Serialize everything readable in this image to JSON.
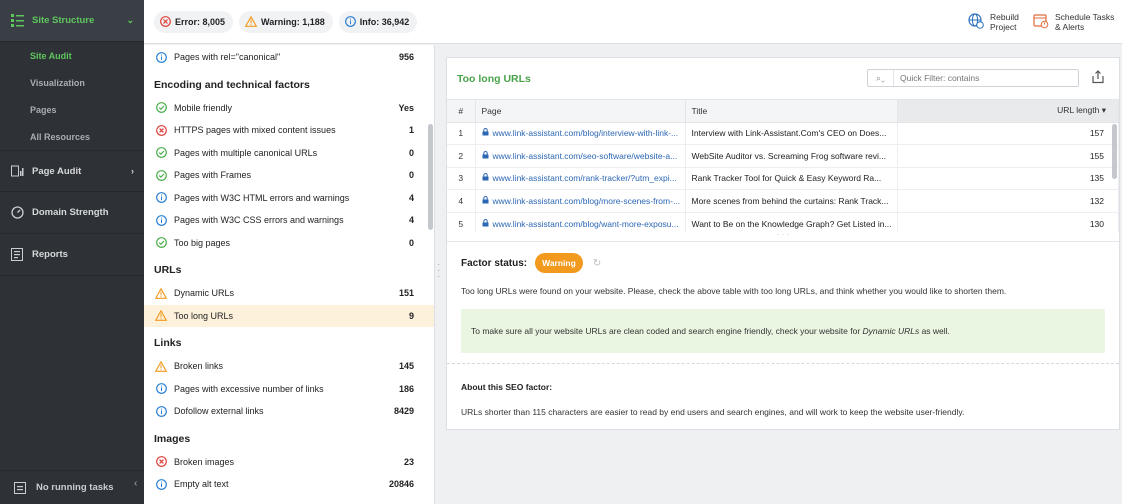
{
  "sidebar": {
    "site_structure": "Site Structure",
    "sub_items": [
      "Site Audit",
      "Visualization",
      "Pages",
      "All Resources"
    ],
    "page_audit": "Page Audit",
    "domain_strength": "Domain Strength",
    "reports": "Reports",
    "running_tasks": "No running tasks"
  },
  "topbar": {
    "error": "Error: 8,005",
    "warning": "Warning: 1,188",
    "info": "Info: 36,942",
    "rebuild_line1": "Rebuild",
    "rebuild_line2": "Project",
    "schedule_line1": "Schedule Tasks",
    "schedule_line2": "& Alerts"
  },
  "factors": {
    "canonical": {
      "label": "Pages with rel=\"canonical\"",
      "value": "956",
      "icon": "info-icon"
    },
    "encoding_header": "Encoding and technical factors",
    "encoding": [
      {
        "label": "Mobile friendly",
        "value": "Yes",
        "icon": "check-icon"
      },
      {
        "label": "HTTPS pages with mixed content issues",
        "value": "1",
        "icon": "error-icon"
      },
      {
        "label": "Pages with multiple canonical URLs",
        "value": "0",
        "icon": "check-icon"
      },
      {
        "label": "Pages with Frames",
        "value": "0",
        "icon": "check-icon"
      },
      {
        "label": "Pages with W3C HTML errors and warnings",
        "value": "4",
        "icon": "info-icon"
      },
      {
        "label": "Pages with W3C CSS errors and warnings",
        "value": "4",
        "icon": "info-icon"
      },
      {
        "label": "Too big pages",
        "value": "0",
        "icon": "check-icon"
      }
    ],
    "urls_header": "URLs",
    "urls": [
      {
        "label": "Dynamic URLs",
        "value": "151",
        "icon": "warning-icon"
      },
      {
        "label": "Too long URLs",
        "value": "9",
        "icon": "warning-icon"
      }
    ],
    "links_header": "Links",
    "links": [
      {
        "label": "Broken links",
        "value": "145",
        "icon": "warning-icon"
      },
      {
        "label": "Pages with excessive number of links",
        "value": "186",
        "icon": "info-icon"
      },
      {
        "label": "Dofollow external links",
        "value": "8429",
        "icon": "info-icon"
      }
    ],
    "images_header": "Images",
    "images": [
      {
        "label": "Broken images",
        "value": "23",
        "icon": "error-icon"
      },
      {
        "label": "Empty alt text",
        "value": "20846",
        "icon": "info-icon"
      }
    ]
  },
  "panel": {
    "title": "Too long URLs",
    "filter_placeholder": "Quick Filter: contains",
    "columns": {
      "num": "#",
      "page": "Page",
      "title": "Title",
      "length": "URL length ▾"
    },
    "rows": [
      {
        "n": "1",
        "page": "www.link-assistant.com/blog/interview-with-link-...",
        "title": "Interview with Link-Assistant.Com's CEO on Does...",
        "length": "157"
      },
      {
        "n": "2",
        "page": "www.link-assistant.com/seo-software/website-a...",
        "title": "WebSite Auditor vs. Screaming Frog software revi...",
        "length": "155"
      },
      {
        "n": "3",
        "page": "www.link-assistant.com/rank-tracker/?utm_expi...",
        "title": "Rank Tracker Tool for Quick & Easy Keyword Ra...",
        "length": "135"
      },
      {
        "n": "4",
        "page": "www.link-assistant.com/blog/more-scenes-from-...",
        "title": "More scenes from behind the curtains: Rank Track...",
        "length": "132"
      },
      {
        "n": "5",
        "page": "www.link-assistant.com/blog/want-more-exposu...",
        "title": "Want to Be on the Knowledge Graph? Get Listed in...",
        "length": "130"
      }
    ],
    "factor_status_label": "Factor status:",
    "factor_status_badge": "Warning",
    "status_text": "Too long URLs were found on your website. Please, check the above table with too long URLs, and think whether you would like to shorten them.",
    "tip_pre": "To make sure all your website URLs are clean coded and search engine friendly, check your website for ",
    "tip_em": "Dynamic URLs",
    "tip_post": " as well.",
    "about_title": "About this SEO factor:",
    "about_text": "URLs shorter than 115 characters are easier to read by end users and search engines, and will work to keep the website user-friendly."
  },
  "colors": {
    "accent_green": "#5fc55f",
    "warning_orange": "#f29a1e",
    "error_red": "#e0413a",
    "info_blue": "#2a7fd4"
  }
}
